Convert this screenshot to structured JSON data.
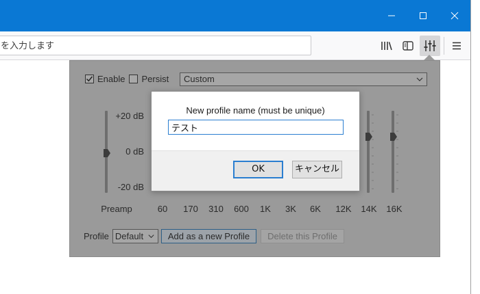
{
  "browser": {
    "url_placeholder": "を入力します",
    "accent_color": "#0a78d4"
  },
  "toolbar": {
    "icons": [
      "library-icon",
      "sidebar-icon",
      "equalizer-icon",
      "menu-icon"
    ]
  },
  "equalizer": {
    "enable_label": "Enable",
    "enable_checked": true,
    "persist_label": "Persist",
    "persist_checked": false,
    "preset_value": "Custom",
    "db_labels": {
      "top": "+20 dB",
      "middle": "0 dB",
      "bottom": "-20 dB"
    },
    "preamp_label": "Preamp",
    "bands": [
      "60",
      "170",
      "310",
      "600",
      "1K",
      "3K",
      "6K",
      "12K",
      "14K",
      "16K"
    ],
    "preamp_level_db": 0,
    "visible_band_levels_db": {
      "14K": 8,
      "16K": 8
    }
  },
  "profile": {
    "label": "Profile",
    "selected": "Default",
    "add_button": "Add as a new Profile",
    "delete_button": "Delete this Profile"
  },
  "dialog": {
    "prompt": "New profile name (must be unique)",
    "input_value": "テスト",
    "ok_button": "OK",
    "cancel_button": "キャンセル"
  }
}
